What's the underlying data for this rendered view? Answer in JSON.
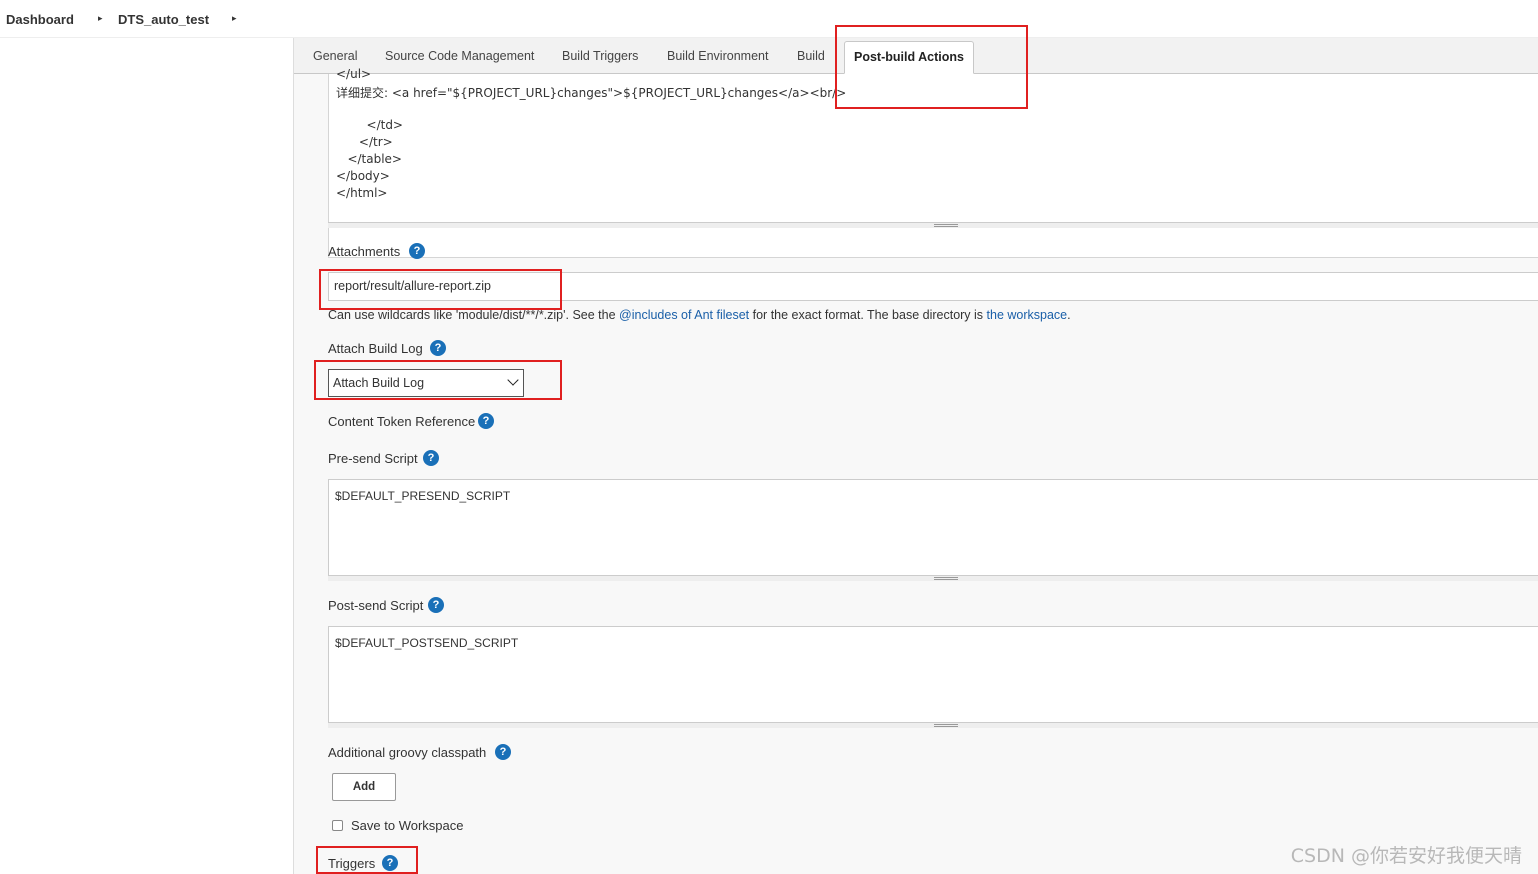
{
  "breadcrumb": {
    "items": [
      "Dashboard",
      "DTS_auto_test"
    ],
    "separator": "▸"
  },
  "tabs": [
    "General",
    "Source Code Management",
    "Build Triggers",
    "Build Environment",
    "Build",
    "Post-build Actions"
  ],
  "active_tab": "Post-build Actions",
  "code_lines": [
    "</ul>",
    "详细提交: <a href=\"${PROJECT_URL}changes\">${PROJECT_URL}changes</a><br/>",
    "        </td>",
    "      </tr>",
    "   </table>",
    "</body>",
    "</html>"
  ],
  "attachments": {
    "label": "Attachments",
    "value": "report/result/allure-report.zip",
    "hint_prefix": "Can use wildcards like 'module/dist/**/*.zip'. See the ",
    "hint_link1": "@includes of Ant fileset",
    "hint_middle": " for the exact format. The base directory is ",
    "hint_link2": "the workspace",
    "hint_suffix": "."
  },
  "attach_build_log": {
    "label": "Attach Build Log",
    "selected": "Attach Build Log"
  },
  "content_token_reference": {
    "label": "Content Token Reference"
  },
  "pre_send_script": {
    "label": "Pre-send Script",
    "value": "$DEFAULT_PRESEND_SCRIPT"
  },
  "post_send_script": {
    "label": "Post-send Script",
    "value": "$DEFAULT_POSTSEND_SCRIPT"
  },
  "groovy_classpath": {
    "label": "Additional groovy classpath",
    "add_button": "Add"
  },
  "save_to_workspace": {
    "label": "Save to Workspace",
    "checked": false
  },
  "triggers": {
    "label": "Triggers"
  },
  "help_glyph": "?",
  "icons": {
    "help": "question-circle-icon",
    "dropdown": "chevron-down-icon"
  },
  "colors": {
    "help": "#1a70b8",
    "highlight": "#e02020",
    "link": "#1a5fa8"
  },
  "watermark": "CSDN @你若安好我便天晴"
}
